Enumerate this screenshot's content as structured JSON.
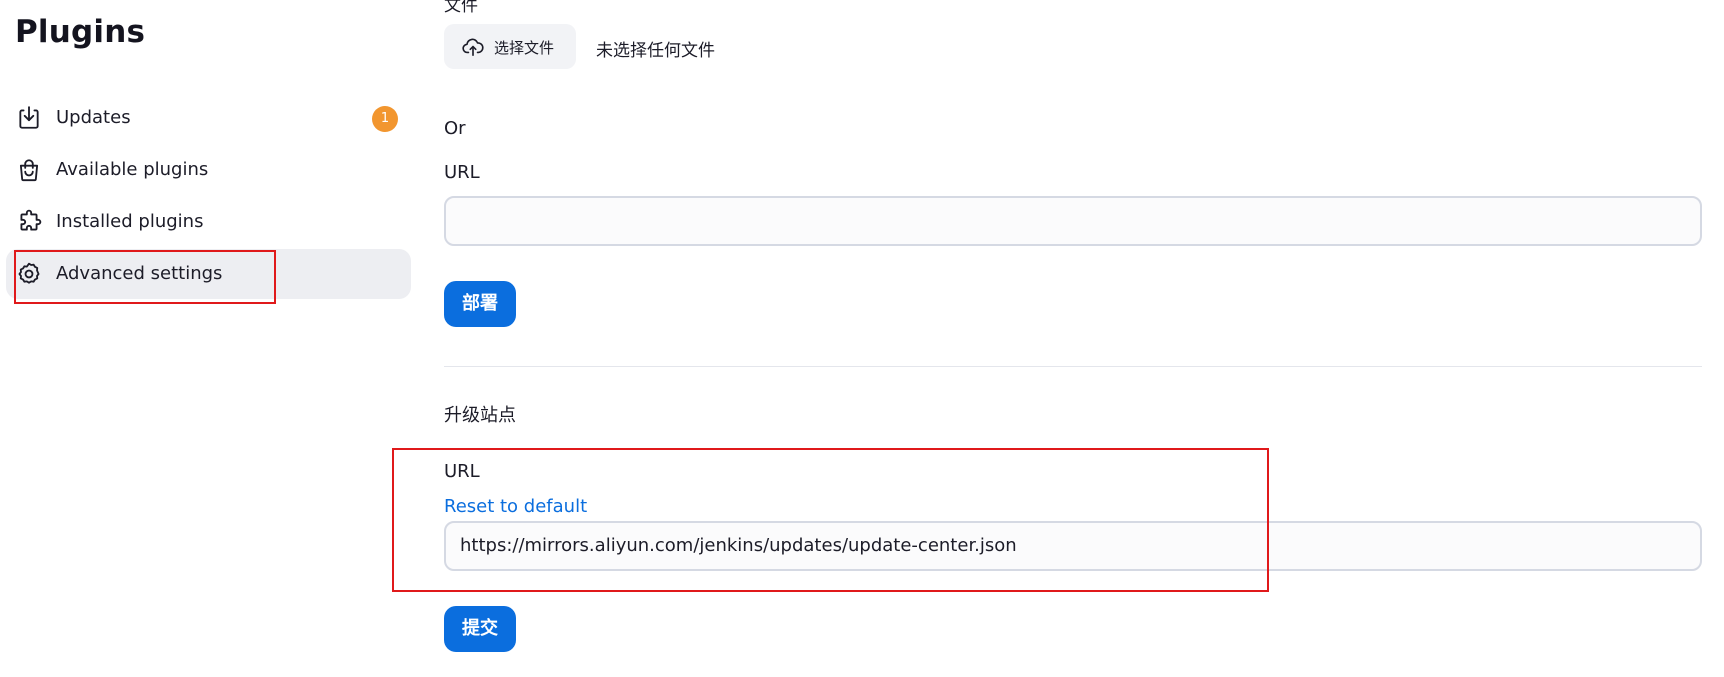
{
  "sidebar": {
    "title": "Plugins",
    "items": [
      {
        "label": "Updates",
        "icon": "download-icon",
        "badge": "1"
      },
      {
        "label": "Available plugins",
        "icon": "shopping-bag-icon"
      },
      {
        "label": "Installed plugins",
        "icon": "puzzle-icon"
      },
      {
        "label": "Advanced settings",
        "icon": "gear-icon",
        "active": true
      }
    ]
  },
  "upload": {
    "section_label": "文件",
    "choose_button": "选择文件",
    "no_file_text": "未选择任何文件",
    "or_label": "Or",
    "url_label": "URL",
    "url_value": "",
    "deploy_button": "部署"
  },
  "update_site": {
    "heading": "升级站点",
    "url_label": "URL",
    "reset_link": "Reset to default",
    "url_value": "https://mirrors.aliyun.com/jenkins/updates/update-center.json",
    "submit_button": "提交"
  },
  "colors": {
    "primary": "#0b6ede",
    "badge": "#f2962f",
    "highlight": "#e0191b",
    "active_bg": "#edeef2"
  }
}
